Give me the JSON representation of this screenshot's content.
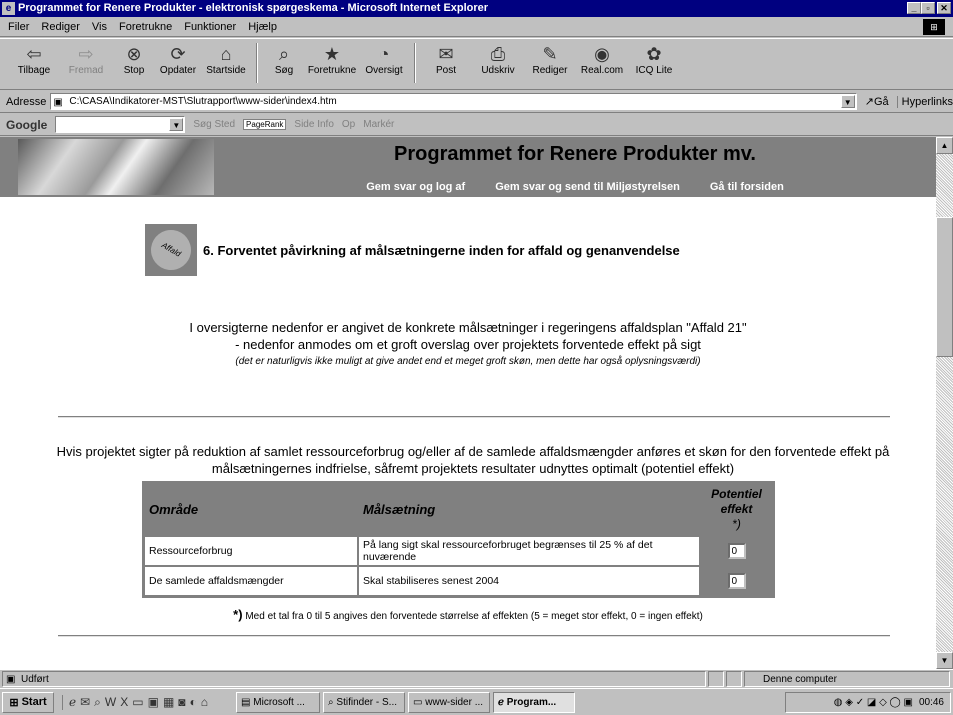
{
  "window": {
    "title": "Programmet for Renere Produkter - elektronisk spørgeskema - Microsoft Internet Explorer"
  },
  "menu": [
    "Filer",
    "Rediger",
    "Vis",
    "Foretrukne",
    "Funktioner",
    "Hjælp"
  ],
  "toolbar": {
    "back": "Tilbage",
    "forward": "Fremad",
    "stop": "Stop",
    "refresh": "Opdater",
    "home": "Startside",
    "search": "Søg",
    "favorites": "Foretrukne",
    "history": "Oversigt",
    "mail": "Post",
    "print": "Udskriv",
    "edit": "Rediger",
    "realcom": "Real.com",
    "icq": "ICQ Lite"
  },
  "address": {
    "label": "Adresse",
    "value": "C:\\CASA\\Indikatorer-MST\\Slutrapport\\www-sider\\index4.htm",
    "go": "Gå",
    "links": "Hyperlinks"
  },
  "google": {
    "logo": "Google",
    "search_site": "Søg Sted",
    "pagerank": "PageRank",
    "page_info": "Side Info",
    "up": "Op",
    "highlight": "Markér"
  },
  "page": {
    "site_title": "Programmet for Renere Produkter mv.",
    "nav": {
      "save_logout": "Gem svar og log af",
      "save_send": "Gem svar og send til Miljøstyrelsen",
      "home": "Gå til forsiden"
    },
    "section_logo": "Affald",
    "section_title": "6. Forventet påvirkning af målsætningerne inden for affald og genanvendelse",
    "intro_line1": "I oversigterne nedenfor er angivet de konkrete målsætninger i regeringens affaldsplan \"Affald 21\"",
    "intro_line2": "- nedenfor anmodes om et groft overslag over projektets forventede effekt på sigt",
    "intro_note": "(det er naturligvis ikke muligt at give andet end et meget groft skøn, men dette har også oplysningsværdi)",
    "paragraph": "Hvis projektet sigter på reduktion af samlet ressourceforbrug og/eller af de samlede affaldsmængder anføres et skøn for den forventede effekt på målsætningernes indfrielse, såfremt projektets resultater udnyttes optimalt (potentiel effekt)",
    "table": {
      "headers": {
        "area": "Område",
        "goal": "Målsætning",
        "effect": "Potentiel effekt",
        "effect_marker": "*)"
      },
      "rows": [
        {
          "area": "Ressourceforbrug",
          "goal": "På lang sigt skal ressourceforbruget begrænses til 25 % af det nuværende",
          "value": "0"
        },
        {
          "area": "De samlede affaldsmængder",
          "goal": "Skal stabiliseres senest 2004",
          "value": "0"
        }
      ]
    },
    "footnote_marker": "*)",
    "footnote": "Med et tal fra 0 til 5 angives den forventede størrelse af effekten (5 = meget stor effekt, 0 = ingen effekt)"
  },
  "status": {
    "text": "Udført",
    "zone": "Denne computer"
  },
  "taskbar": {
    "start": "Start",
    "tasks": [
      "Microsoft ...",
      "Stifinder - S...",
      "www-sider ...",
      "Program..."
    ],
    "clock": "00:46"
  }
}
